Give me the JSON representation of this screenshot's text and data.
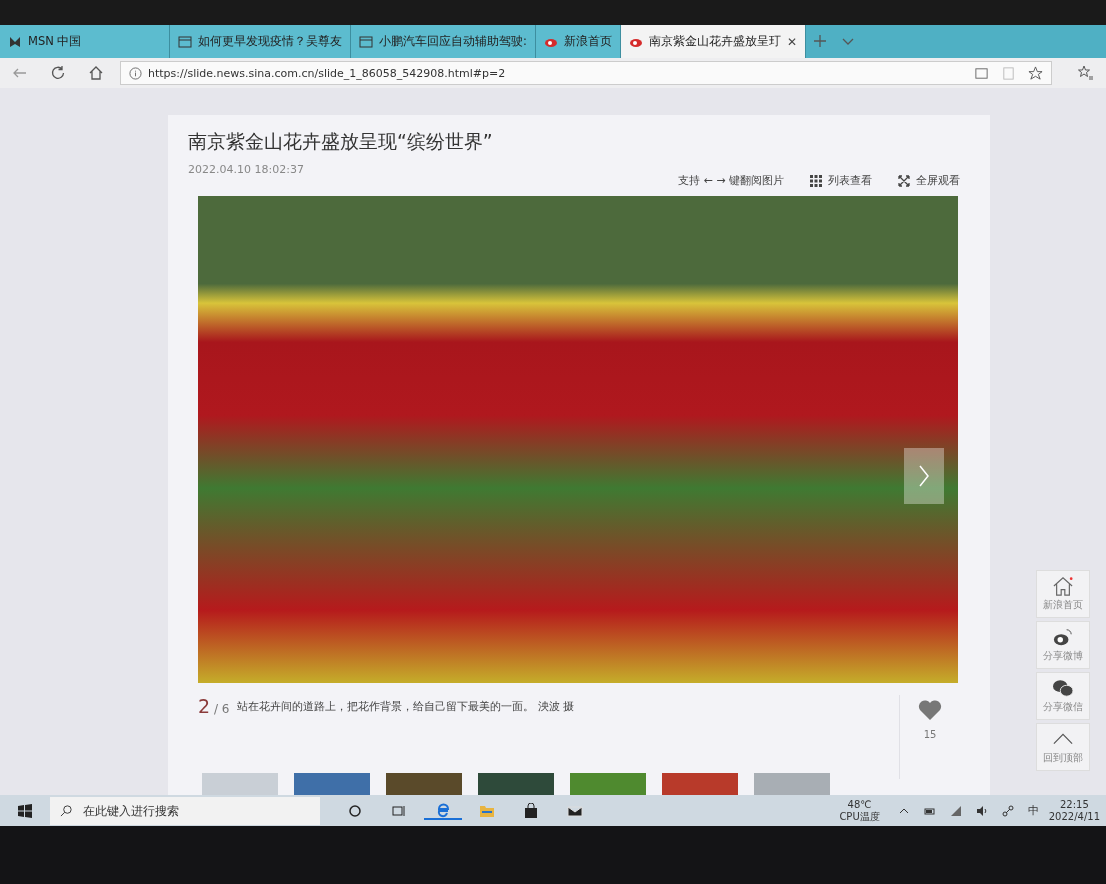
{
  "tabs": [
    {
      "label": "MSN 中国",
      "kind": "msn",
      "selected": false
    },
    {
      "label": "如何更早发现疫情？吴尊友",
      "kind": "page",
      "selected": false
    },
    {
      "label": "小鹏汽车回应自动辅助驾驶:",
      "kind": "page",
      "selected": false
    },
    {
      "label": "新浪首页",
      "kind": "weibo",
      "selected": false
    },
    {
      "label": "南京紫金山花卉盛放呈玎",
      "kind": "weibo",
      "selected": true,
      "close": "✕"
    }
  ],
  "address": {
    "url": "https://slide.news.sina.com.cn/slide_1_86058_542908.html#p=2"
  },
  "article": {
    "title": "南京紫金山花卉盛放呈现“缤纷世界”",
    "date": "2022.04.10 18:02:37",
    "tools": [
      {
        "kind": "keys",
        "label": "支持 ← → 键翻阅图片"
      },
      {
        "kind": "list",
        "label": "列表查看"
      },
      {
        "kind": "fullscreen",
        "label": "全屏观看"
      }
    ],
    "caption": {
      "index": "2",
      "total": "/ 6",
      "text": "站在花卉间的道路上，把花作背景，给自己留下最美的一面。 泱波 摄"
    },
    "likes": "15"
  },
  "sidebar": [
    {
      "kind": "home",
      "label": "新浪首页"
    },
    {
      "kind": "weibo",
      "label": "分享微博"
    },
    {
      "kind": "wechat",
      "label": "分享微信"
    },
    {
      "kind": "top",
      "label": "回到顶部"
    }
  ],
  "taskbar": {
    "search": {
      "placeholder": "在此键入进行搜索"
    },
    "temp": "48℃",
    "temp_label": "CPU温度",
    "ime": "中",
    "time": "22:15",
    "date": "2022/4/11"
  }
}
